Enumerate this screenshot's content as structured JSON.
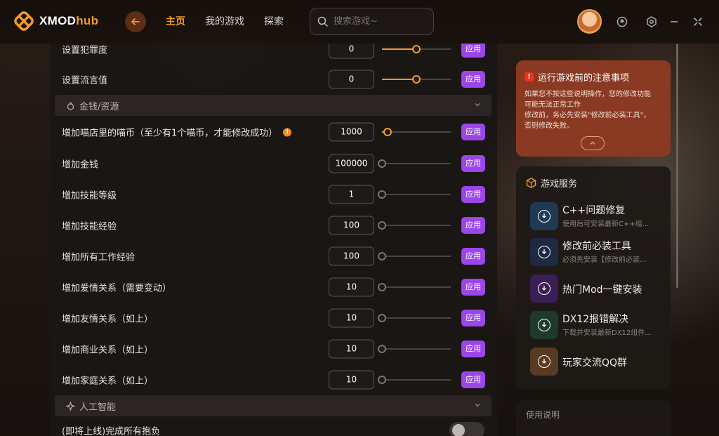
{
  "app": {
    "logo_main": "XMOD",
    "logo_accent": "hub"
  },
  "nav": {
    "items": [
      {
        "label": "主页",
        "active": true
      },
      {
        "label": "我的游戏",
        "active": false
      },
      {
        "label": "探索",
        "active": false
      }
    ]
  },
  "search": {
    "placeholder": "搜索游戏~"
  },
  "colors": {
    "accent": "#f39a2b",
    "apply": "#9b46e8",
    "notice_bg": "#8a3a22"
  },
  "rows_top": [
    {
      "label": "设置犯罪度",
      "value": "0",
      "apply": "应用",
      "slider_fraction": 0.5
    },
    {
      "label": "设置流言值",
      "value": "0",
      "apply": "应用",
      "slider_fraction": 0.5
    }
  ],
  "section_money": {
    "label": "金钱/资源"
  },
  "rows_money": [
    {
      "label": "增加喵店里的喵币（至少有1个喵币，才能修改成功）",
      "info": "i",
      "value": "1000",
      "apply": "应用",
      "slider_fraction": 0.08
    },
    {
      "label": "增加金钱",
      "value": "100000",
      "apply": "应用",
      "slider_fraction": 0
    },
    {
      "label": "增加技能等级",
      "value": "1",
      "apply": "应用",
      "slider_fraction": 0
    },
    {
      "label": "增加技能经验",
      "value": "100",
      "apply": "应用",
      "slider_fraction": 0
    },
    {
      "label": "增加所有工作经验",
      "value": "100",
      "apply": "应用",
      "slider_fraction": 0
    },
    {
      "label": "增加爱情关系（需要变动）",
      "value": "10",
      "apply": "应用",
      "slider_fraction": 0
    },
    {
      "label": "增加友情关系（如上）",
      "value": "10",
      "apply": "应用",
      "slider_fraction": 0
    },
    {
      "label": "增加商业关系（如上）",
      "value": "10",
      "apply": "应用",
      "slider_fraction": 0
    },
    {
      "label": "增加家庭关系（如上）",
      "value": "10",
      "apply": "应用",
      "slider_fraction": 0
    }
  ],
  "section_ai": {
    "label": "人工智能"
  },
  "row_ai": {
    "label": "(即将上线)完成所有抱负"
  },
  "notice": {
    "title": "运行游戏前的注意事项",
    "line1": "如果您不按这些说明操作，您的修改功能",
    "line2": "可能无法正常工作",
    "line3": "修改前，务必先安装\"修改前必装工具\"，",
    "line4": "否则修改失败。"
  },
  "services": {
    "title": "游戏服务",
    "items": [
      {
        "name": "C++问题修复",
        "desc": "使用后可安装最新C++组...",
        "color": "#1f3a55"
      },
      {
        "name": "修改前必装工具",
        "desc": "必须先安装【修改前必装...",
        "color": "#1e2a44"
      },
      {
        "name": "热门Mod一键安装",
        "desc": "",
        "color": "#3b1e55"
      },
      {
        "name": "DX12报错解决",
        "desc": "下载并安装最新DX12组件...",
        "color": "#1d3a2c"
      },
      {
        "name": "玩家交流QQ群",
        "desc": "",
        "color": "#5a3a22"
      }
    ]
  },
  "usage": {
    "title": "使用说明"
  }
}
